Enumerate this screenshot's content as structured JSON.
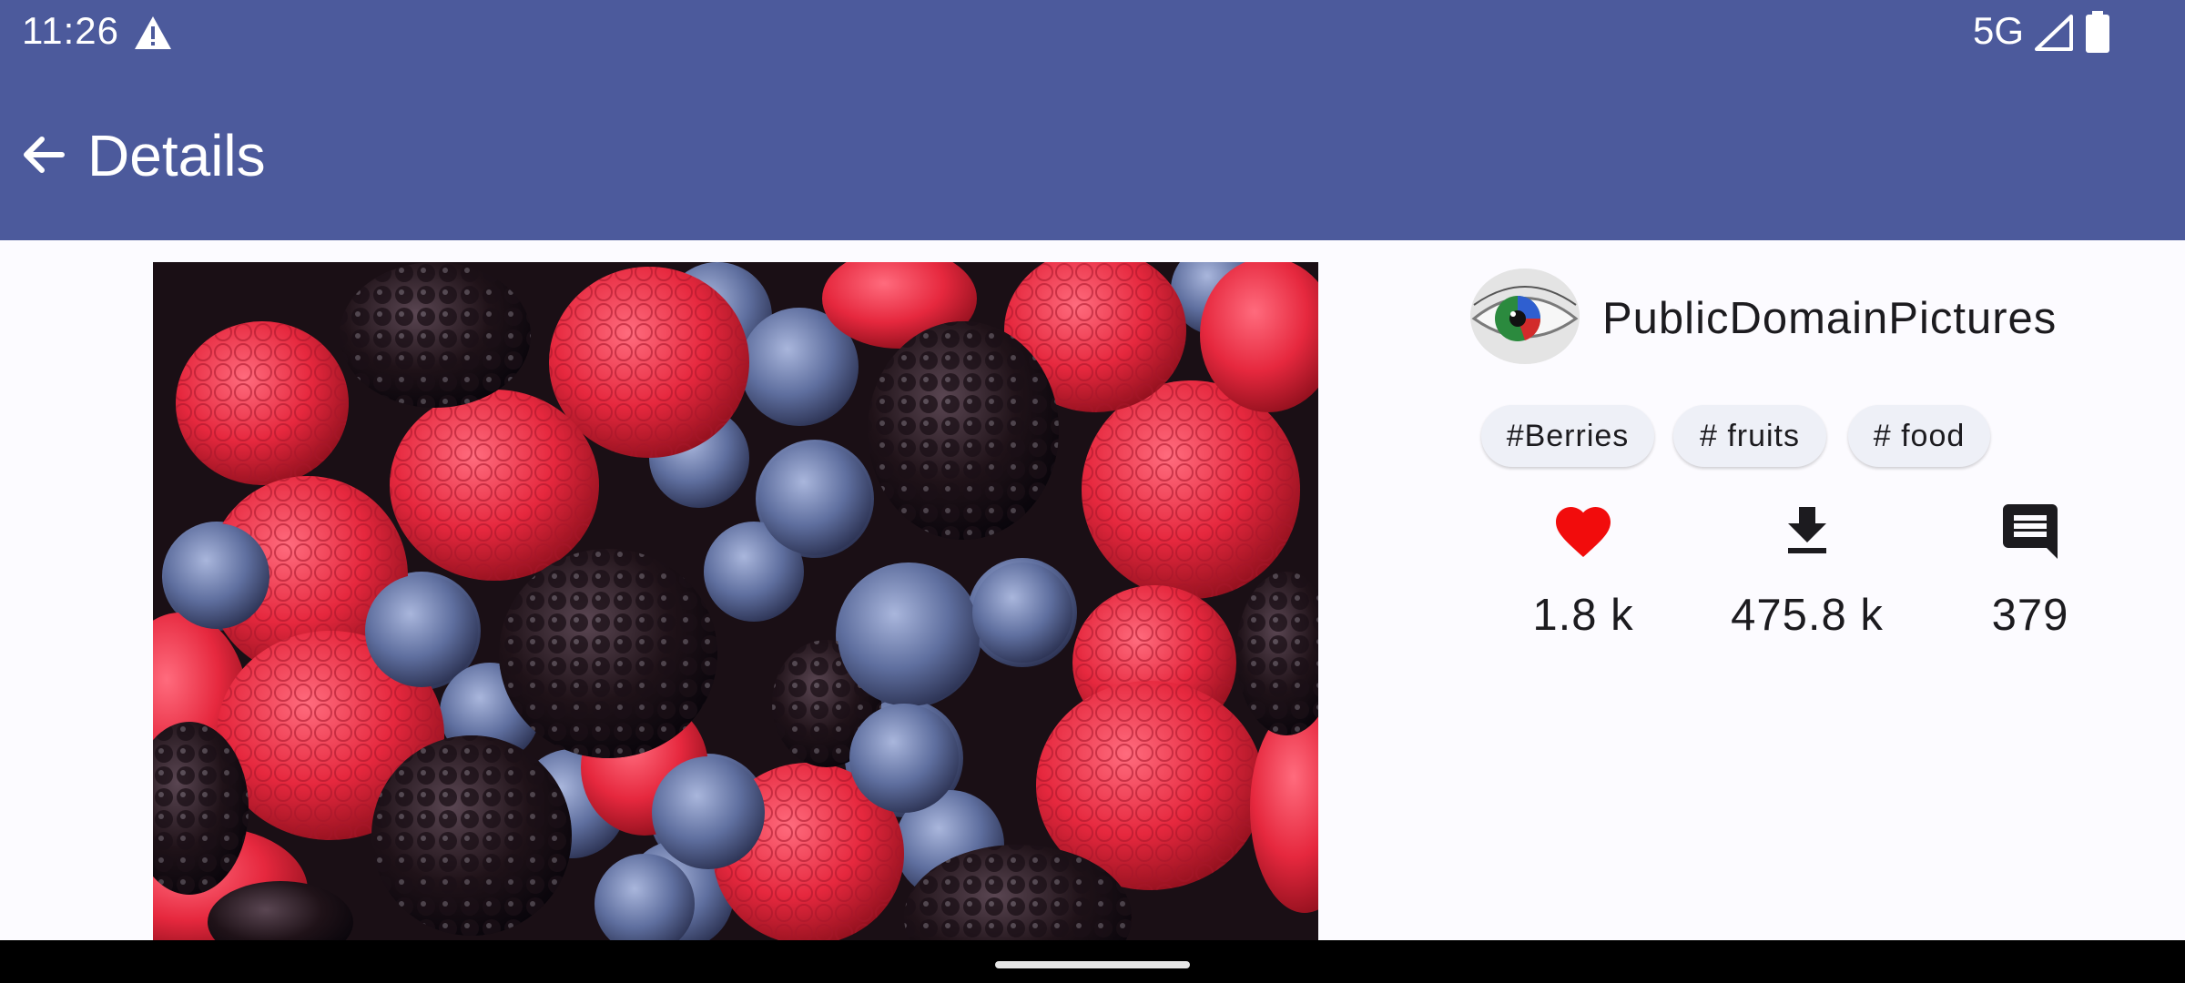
{
  "status_bar": {
    "time": "11:26",
    "network": "5G"
  },
  "app_bar": {
    "title": "Details"
  },
  "user": {
    "name": "PublicDomainPictures"
  },
  "tags": [
    "#Berries",
    "# fruits",
    "# food"
  ],
  "stats": {
    "likes": "1.8 k",
    "downloads": "475.8 k",
    "comments": "379"
  },
  "icons": {
    "warning": "warning-icon",
    "signal": "signal-icon",
    "battery": "battery-icon",
    "back": "arrow-back-icon",
    "like": "heart-icon",
    "download": "download-icon",
    "comment": "comment-icon"
  },
  "colors": {
    "app_bar": "#4c5a9c",
    "like": "#f20c0c",
    "background": "#fcfbff"
  }
}
